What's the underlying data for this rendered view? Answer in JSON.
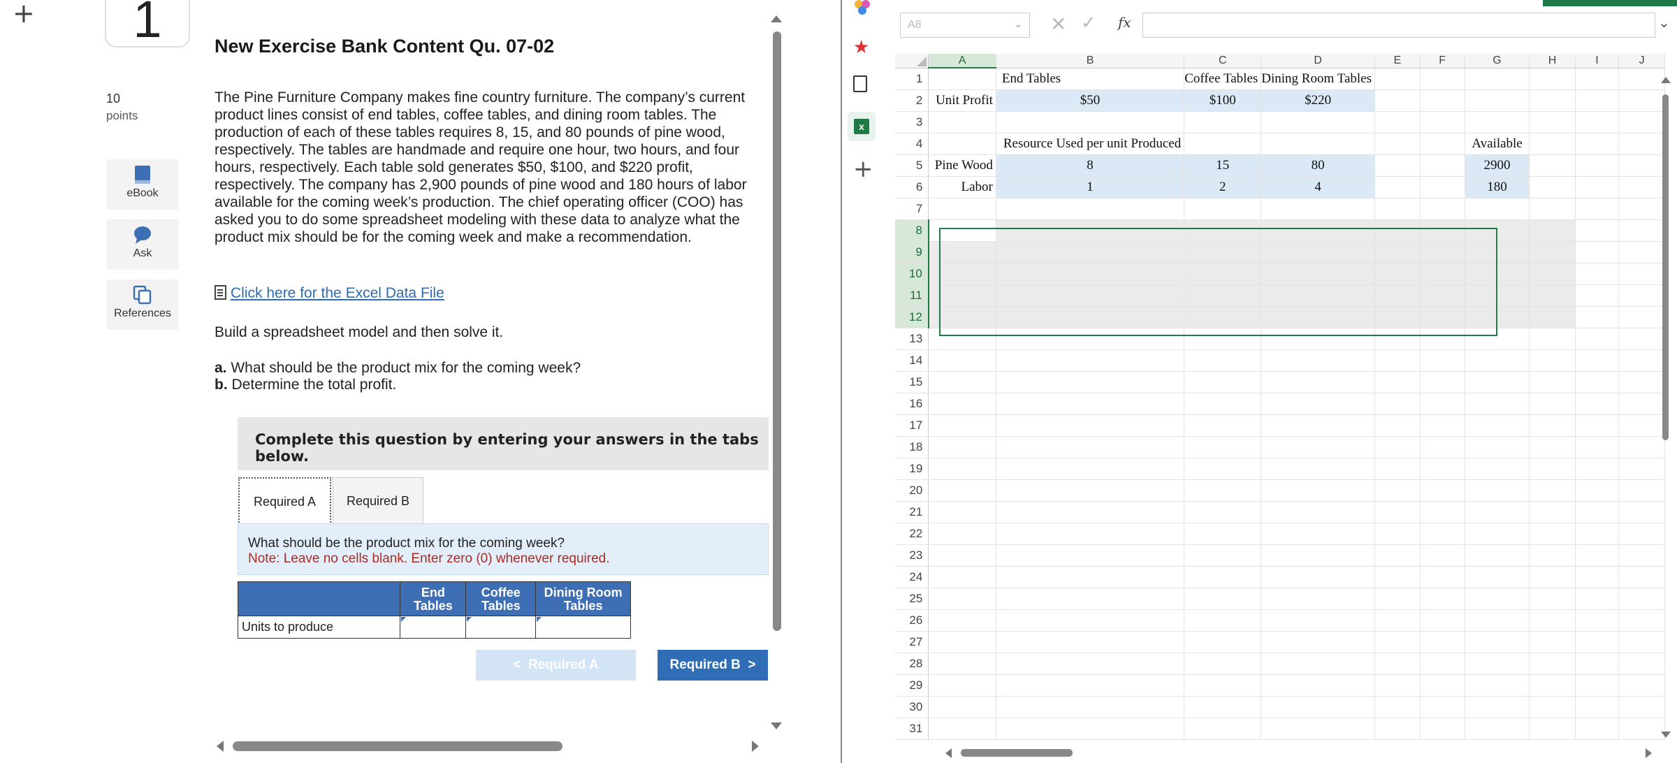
{
  "question": {
    "number": "1",
    "title": "New Exercise Bank Content Qu. 07-02",
    "points_value": "10",
    "points_label": "points",
    "body": "The Pine Furniture Company makes fine country furniture. The company’s current product lines consist of end tables, coffee tables, and dining room tables. The production of each of these tables requires 8, 15, and 80 pounds of pine wood, respectively. The tables are handmade and require one hour, two hours, and four hours, respectively. Each table sold generates $50, $100, and $220 profit, respectively. The company has 2,900 pounds of pine wood and 180 hours of labor available for the coming week’s production. The chief operating officer (COO) has asked you to do some spreadsheet modeling with these data to analyze what the product mix should be for the coming week and make a recommendation.",
    "excel_link": "Click here for the Excel Data File",
    "build_text": "Build a spreadsheet model and then solve it.",
    "part_a_label": "a.",
    "part_a_text": "What should be the product mix for the coming week?",
    "part_b_label": "b.",
    "part_b_text": "Determine the total profit.",
    "instruction": "Complete this question by entering your answers in the tabs below."
  },
  "side_tools": [
    {
      "label": "eBook",
      "icon": "book-icon"
    },
    {
      "label": "Ask",
      "icon": "chat-bubble-icon"
    },
    {
      "label": "References",
      "icon": "copy-pages-icon"
    }
  ],
  "tabs": [
    {
      "label": "Required A",
      "active": true
    },
    {
      "label": "Required B",
      "active": false
    }
  ],
  "required_a": {
    "question": "What should be the product mix for the coming week?",
    "note": "Note: Leave no cells blank. Enter zero (0) whenever required.",
    "table": {
      "headers": [
        "End Tables",
        "Coffee Tables",
        "Dining Room Tables"
      ],
      "row_label": "Units to produce",
      "values": [
        "",
        "",
        ""
      ]
    }
  },
  "nav": {
    "prev_label": "Required A",
    "next_label": "Required B"
  },
  "excel": {
    "name_box": "A8",
    "formula": "",
    "fx_label": "fx",
    "columns": [
      "A",
      "B",
      "C",
      "D",
      "E",
      "F",
      "G",
      "H",
      "I",
      "J"
    ],
    "rows": {
      "1": {
        "B": "End Tables",
        "C": "Coffee Tables",
        "D": "Dining Room Tables"
      },
      "2": {
        "A": "Unit Profit",
        "B": "$50",
        "C": "$100",
        "D": "$220"
      },
      "4": {
        "B": "Resource Used per unit Produced",
        "G": "Available"
      },
      "5": {
        "A": "Pine Wood",
        "B": "8",
        "C": "15",
        "D": "80",
        "G": "2900"
      },
      "6": {
        "A": "Labor",
        "B": "1",
        "C": "2",
        "D": "4",
        "G": "180"
      }
    },
    "row1_display": {
      "B": "End Tables",
      "C": "Coffee Tables",
      "D": "ng Room Tables"
    },
    "row1_C_clip": "Coffee Table"
  },
  "colors": {
    "link": "#2a6cb5",
    "note_red": "#b22a1f",
    "table_header": "#3e6fb5",
    "excel_green": "#1e7a46",
    "cell_blue": "#dbe9f6"
  }
}
